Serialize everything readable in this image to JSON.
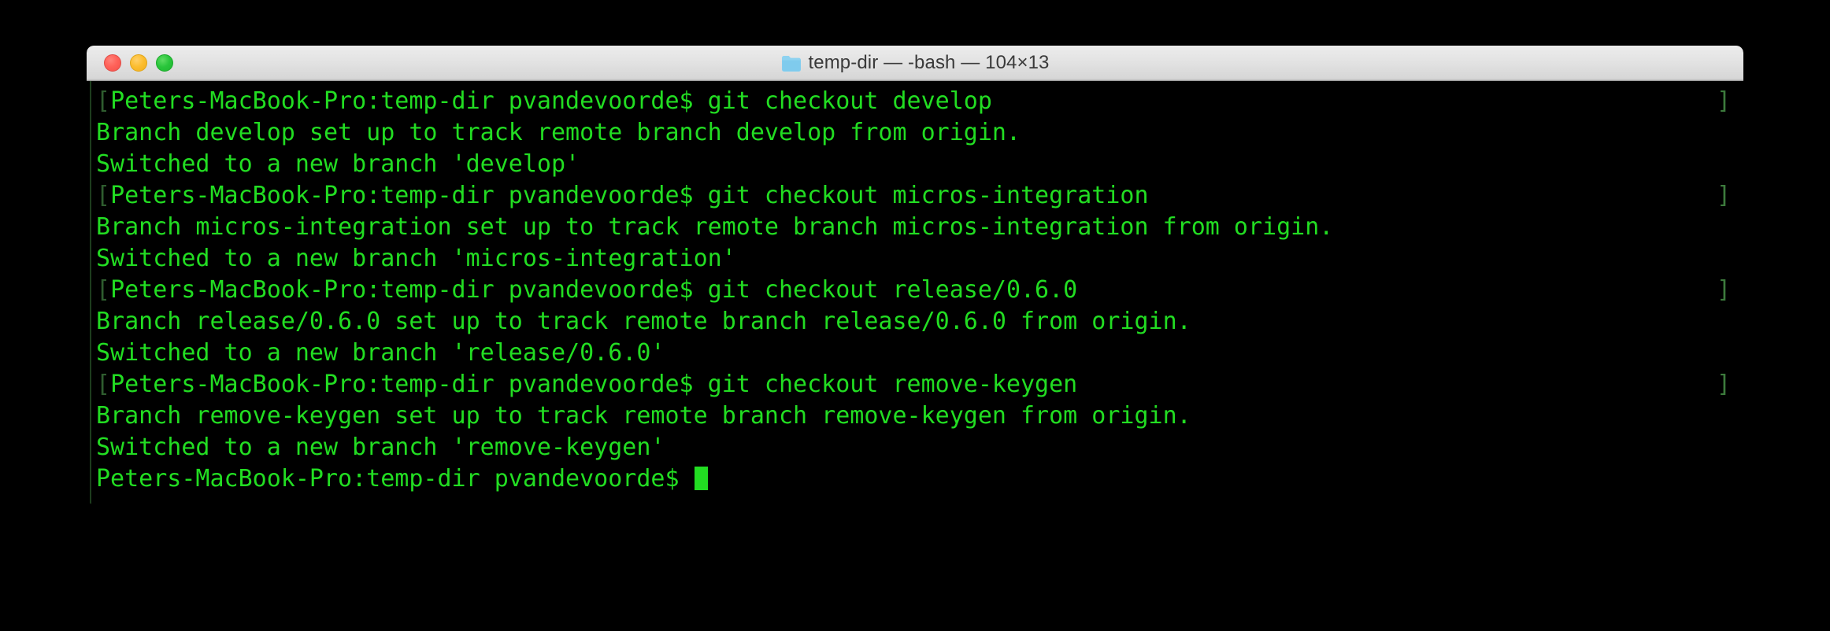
{
  "window": {
    "title": "temp-dir — -bash — 104×13",
    "folder_icon": "folder-icon",
    "columns": 104,
    "rows": 13,
    "shell": "-bash",
    "directory": "temp-dir",
    "traffic_lights": {
      "close_label": "close",
      "minimize_label": "minimize",
      "maximize_label": "maximize",
      "close_color": "#ff6259",
      "minimize_color": "#fcbd2e",
      "maximize_color": "#29c53b"
    }
  },
  "terminal": {
    "foreground_color": "#22dd22",
    "background_color": "#000000",
    "prompt": "Peters-MacBook-Pro:temp-dir pvandevoorde$ ",
    "marker_left": "[",
    "marker_right": "]",
    "cursor": "block",
    "lines": [
      {
        "marker_left": "[",
        "text": "Peters-MacBook-Pro:temp-dir pvandevoorde$ git checkout develop",
        "marker_right": "]",
        "type": "prompt"
      },
      {
        "marker_left": "",
        "text": "Branch develop set up to track remote branch develop from origin.",
        "marker_right": "",
        "type": "output"
      },
      {
        "marker_left": "",
        "text": "Switched to a new branch 'develop'",
        "marker_right": "",
        "type": "output"
      },
      {
        "marker_left": "[",
        "text": "Peters-MacBook-Pro:temp-dir pvandevoorde$ git checkout micros-integration",
        "marker_right": "]",
        "type": "prompt"
      },
      {
        "marker_left": "",
        "text": "Branch micros-integration set up to track remote branch micros-integration from origin.",
        "marker_right": "",
        "type": "output"
      },
      {
        "marker_left": "",
        "text": "Switched to a new branch 'micros-integration'",
        "marker_right": "",
        "type": "output"
      },
      {
        "marker_left": "[",
        "text": "Peters-MacBook-Pro:temp-dir pvandevoorde$ git checkout release/0.6.0",
        "marker_right": "]",
        "type": "prompt"
      },
      {
        "marker_left": "",
        "text": "Branch release/0.6.0 set up to track remote branch release/0.6.0 from origin.",
        "marker_right": "",
        "type": "output"
      },
      {
        "marker_left": "",
        "text": "Switched to a new branch 'release/0.6.0'",
        "marker_right": "",
        "type": "output"
      },
      {
        "marker_left": "[",
        "text": "Peters-MacBook-Pro:temp-dir pvandevoorde$ git checkout remove-keygen",
        "marker_right": "]",
        "type": "prompt"
      },
      {
        "marker_left": "",
        "text": "Branch remove-keygen set up to track remote branch remove-keygen from origin.",
        "marker_right": "",
        "type": "output"
      },
      {
        "marker_left": "",
        "text": "Switched to a new branch 'remove-keygen'",
        "marker_right": "",
        "type": "output"
      },
      {
        "marker_left": "",
        "text": "Peters-MacBook-Pro:temp-dir pvandevoorde$ ",
        "marker_right": "",
        "type": "active-prompt"
      }
    ]
  }
}
